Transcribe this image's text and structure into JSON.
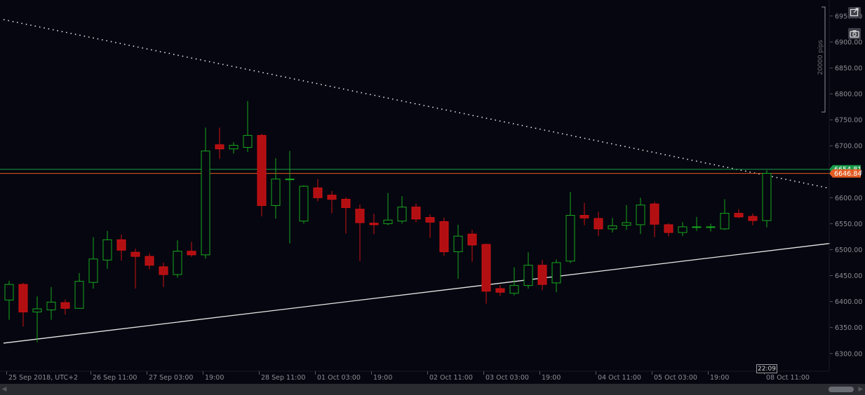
{
  "chart_data": {
    "type": "candlestick",
    "y_axis": {
      "ylim": [
        6270,
        6970
      ],
      "tick_labels": [
        "6950.00",
        "6900.00",
        "6850.00",
        "6800.00",
        "6750.00",
        "6700.00",
        "6650.00",
        "6600.00",
        "6550.00",
        "6500.00",
        "6450.00",
        "6400.00",
        "6350.00",
        "6300.00"
      ],
      "tick_values": [
        6950,
        6900,
        6850,
        6800,
        6750,
        6700,
        6650,
        6600,
        6550,
        6500,
        6450,
        6400,
        6350,
        6300
      ]
    },
    "x_axis": {
      "labels": [
        {
          "text": "25 Sep 2018, UTC+2",
          "index": 0
        },
        {
          "text": "26 Sep 11:00",
          "index": 6
        },
        {
          "text": "27 Sep 03:00",
          "index": 10
        },
        {
          "text": "19:00",
          "index": 14
        },
        {
          "text": "28 Sep 11:00",
          "index": 18
        },
        {
          "text": "01 Oct 03:00",
          "index": 22
        },
        {
          "text": "19:00",
          "index": 26
        },
        {
          "text": "02 Oct 11:00",
          "index": 30
        },
        {
          "text": "03 Oct 03:00",
          "index": 34
        },
        {
          "text": "19:00",
          "index": 38
        },
        {
          "text": "04 Oct 11:00",
          "index": 42
        },
        {
          "text": "05 Oct 03:00",
          "index": 46
        },
        {
          "text": "19:00",
          "index": 50
        },
        {
          "text": "08 Oct 11:00",
          "index": 54
        }
      ]
    },
    "candles": [
      {
        "o": 6403,
        "h": 6440,
        "l": 6365,
        "c": 6433
      },
      {
        "o": 6433,
        "h": 6436,
        "l": 6352,
        "c": 6380
      },
      {
        "o": 6380,
        "h": 6410,
        "l": 6322,
        "c": 6386
      },
      {
        "o": 6384,
        "h": 6428,
        "l": 6365,
        "c": 6399
      },
      {
        "o": 6398,
        "h": 6404,
        "l": 6375,
        "c": 6387
      },
      {
        "o": 6387,
        "h": 6455,
        "l": 6387,
        "c": 6439
      },
      {
        "o": 6437,
        "h": 6524,
        "l": 6425,
        "c": 6482
      },
      {
        "o": 6480,
        "h": 6536,
        "l": 6463,
        "c": 6519
      },
      {
        "o": 6519,
        "h": 6529,
        "l": 6479,
        "c": 6499
      },
      {
        "o": 6495,
        "h": 6502,
        "l": 6425,
        "c": 6487
      },
      {
        "o": 6487,
        "h": 6493,
        "l": 6462,
        "c": 6470
      },
      {
        "o": 6467,
        "h": 6475,
        "l": 6428,
        "c": 6452
      },
      {
        "o": 6452,
        "h": 6518,
        "l": 6446,
        "c": 6497
      },
      {
        "o": 6497,
        "h": 6515,
        "l": 6486,
        "c": 6490
      },
      {
        "o": 6490,
        "h": 6735,
        "l": 6483,
        "c": 6690
      },
      {
        "o": 6702,
        "h": 6735,
        "l": 6675,
        "c": 6694
      },
      {
        "o": 6694,
        "h": 6707,
        "l": 6685,
        "c": 6701
      },
      {
        "o": 6697,
        "h": 6786,
        "l": 6688,
        "c": 6720
      },
      {
        "o": 6720,
        "h": 6723,
        "l": 6564,
        "c": 6585
      },
      {
        "o": 6585,
        "h": 6676,
        "l": 6560,
        "c": 6636
      },
      {
        "o": 6636,
        "h": 6690,
        "l": 6512,
        "c": 6636
      },
      {
        "o": 6555,
        "h": 6624,
        "l": 6550,
        "c": 6622
      },
      {
        "o": 6619,
        "h": 6636,
        "l": 6593,
        "c": 6600
      },
      {
        "o": 6605,
        "h": 6613,
        "l": 6570,
        "c": 6597
      },
      {
        "o": 6597,
        "h": 6601,
        "l": 6531,
        "c": 6581
      },
      {
        "o": 6578,
        "h": 6587,
        "l": 6478,
        "c": 6552
      },
      {
        "o": 6551,
        "h": 6569,
        "l": 6530,
        "c": 6548
      },
      {
        "o": 6550,
        "h": 6609,
        "l": 6547,
        "c": 6557
      },
      {
        "o": 6555,
        "h": 6603,
        "l": 6550,
        "c": 6582
      },
      {
        "o": 6582,
        "h": 6589,
        "l": 6553,
        "c": 6559
      },
      {
        "o": 6562,
        "h": 6568,
        "l": 6523,
        "c": 6553
      },
      {
        "o": 6554,
        "h": 6562,
        "l": 6488,
        "c": 6496
      },
      {
        "o": 6496,
        "h": 6548,
        "l": 6444,
        "c": 6526
      },
      {
        "o": 6530,
        "h": 6538,
        "l": 6477,
        "c": 6509
      },
      {
        "o": 6510,
        "h": 6512,
        "l": 6396,
        "c": 6420
      },
      {
        "o": 6425,
        "h": 6432,
        "l": 6411,
        "c": 6418
      },
      {
        "o": 6416,
        "h": 6466,
        "l": 6412,
        "c": 6431
      },
      {
        "o": 6431,
        "h": 6495,
        "l": 6425,
        "c": 6470
      },
      {
        "o": 6470,
        "h": 6480,
        "l": 6422,
        "c": 6433
      },
      {
        "o": 6436,
        "h": 6481,
        "l": 6418,
        "c": 6475
      },
      {
        "o": 6478,
        "h": 6611,
        "l": 6474,
        "c": 6566
      },
      {
        "o": 6566,
        "h": 6590,
        "l": 6547,
        "c": 6561
      },
      {
        "o": 6560,
        "h": 6573,
        "l": 6526,
        "c": 6540
      },
      {
        "o": 6540,
        "h": 6561,
        "l": 6533,
        "c": 6546
      },
      {
        "o": 6547,
        "h": 6586,
        "l": 6538,
        "c": 6552
      },
      {
        "o": 6548,
        "h": 6600,
        "l": 6530,
        "c": 6586
      },
      {
        "o": 6588,
        "h": 6592,
        "l": 6524,
        "c": 6549
      },
      {
        "o": 6548,
        "h": 6551,
        "l": 6525,
        "c": 6533
      },
      {
        "o": 6533,
        "h": 6553,
        "l": 6526,
        "c": 6544
      },
      {
        "o": 6544,
        "h": 6563,
        "l": 6536,
        "c": 6544
      },
      {
        "o": 6544,
        "h": 6550,
        "l": 6535,
        "c": 6544
      },
      {
        "o": 6540,
        "h": 6597,
        "l": 6538,
        "c": 6570
      },
      {
        "o": 6570,
        "h": 6578,
        "l": 6561,
        "c": 6563
      },
      {
        "o": 6564,
        "h": 6570,
        "l": 6547,
        "c": 6556
      },
      {
        "o": 6556,
        "h": 6653,
        "l": 6543,
        "c": 6647
      }
    ],
    "horizontal_lines": [
      {
        "value": 6654.81,
        "label": "6654.81",
        "color": "#1a9a4a"
      },
      {
        "value": 6646.84,
        "label": "6646.84",
        "color": "#e35b22"
      }
    ],
    "trendlines": [
      {
        "from": [
          -0.4,
          6943
        ],
        "to": [
          58.5,
          6618
        ],
        "style": "dotted",
        "color": "#e8e8e8"
      },
      {
        "from": [
          -0.4,
          6320
        ],
        "to": [
          58.5,
          6512
        ],
        "style": "solid",
        "color": "#e8e8e8"
      }
    ],
    "measure_label": "20000 pips",
    "colors": {
      "up": "#17a81f",
      "down": "#ce1214",
      "down_fill": "#b20f12",
      "up_fill": "#05060f",
      "background": "#05060f",
      "axis_text": "#8c8e94",
      "grid_tick": "#555760"
    }
  },
  "ui": {
    "cursor_time": "22:09",
    "icons": [
      "expand-icon",
      "camera-icon"
    ]
  }
}
